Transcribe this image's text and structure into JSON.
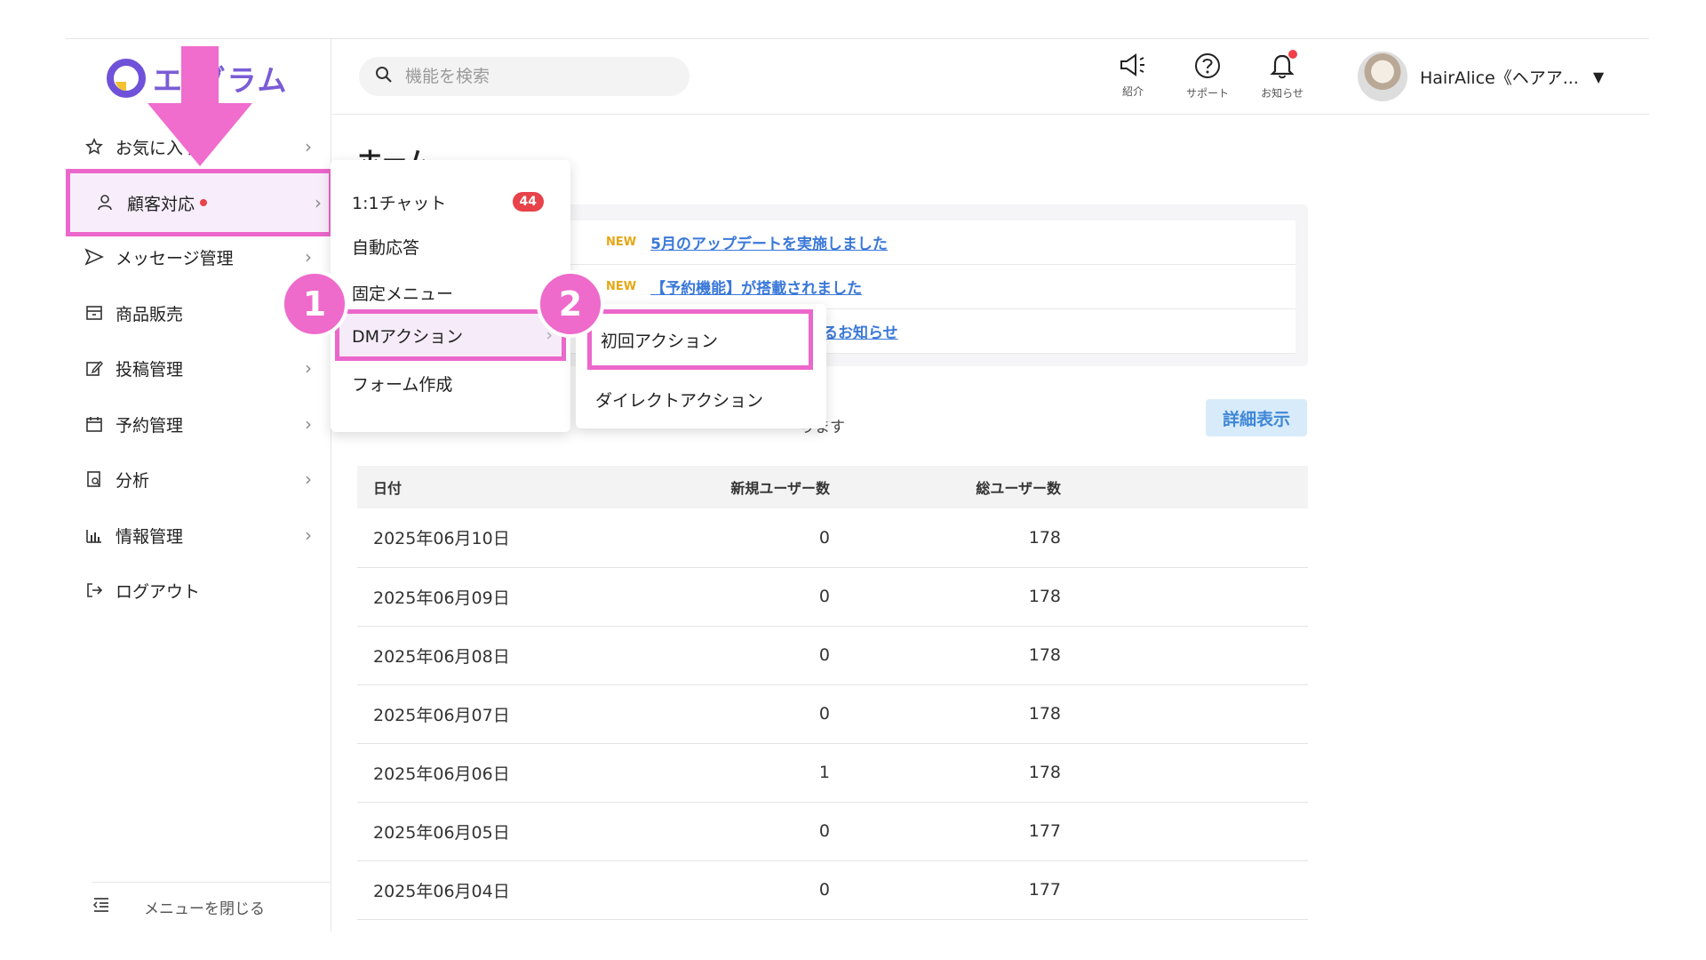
{
  "app": {
    "logo_text": "エ  グラム"
  },
  "sidebar": {
    "items": [
      {
        "label": "お気に入り"
      },
      {
        "label": "顧客対応"
      },
      {
        "label": "メッセージ管理"
      },
      {
        "label": "商品販売"
      },
      {
        "label": "投稿管理"
      },
      {
        "label": "予約管理"
      },
      {
        "label": "分析"
      },
      {
        "label": "情報管理"
      },
      {
        "label": "ログアウト"
      }
    ],
    "close_label": "メニューを閉じる"
  },
  "header": {
    "search_placeholder": "機能を検索",
    "intro_label": "紹介",
    "support_label": "サポート",
    "notify_label": "お知らせ",
    "user_name": "HairAlice《ヘアア..."
  },
  "main": {
    "title": "ホーム",
    "news": [
      {
        "tag": "NEW",
        "text": "5月のアップデートを実施しました"
      },
      {
        "tag": "NEW",
        "text": "【予約機能】が搭載されました"
      },
      {
        "tag": "",
        "text": "るお知らせ"
      }
    ],
    "summary_text": "ります",
    "detail_button": "詳細表示",
    "table": {
      "headers": [
        "日付",
        "新規ユーザー数",
        "総ユーザー数"
      ],
      "rows": [
        [
          "2025年06月10日",
          "0",
          "178"
        ],
        [
          "2025年06月09日",
          "0",
          "178"
        ],
        [
          "2025年06月08日",
          "0",
          "178"
        ],
        [
          "2025年06月07日",
          "0",
          "178"
        ],
        [
          "2025年06月06日",
          "1",
          "178"
        ],
        [
          "2025年06月05日",
          "0",
          "177"
        ],
        [
          "2025年06月04日",
          "0",
          "177"
        ]
      ]
    }
  },
  "flyout1": {
    "items": [
      {
        "label": "1:1チャット",
        "badge": "44"
      },
      {
        "label": "自動応答"
      },
      {
        "label": "固定メニュー"
      },
      {
        "label": "DMアクション"
      },
      {
        "label": "フォーム作成"
      }
    ]
  },
  "flyout2": {
    "items": [
      {
        "label": "初回アクション"
      },
      {
        "label": "ダイレクトアクション"
      }
    ]
  },
  "annotations": {
    "step1": "1",
    "step2": "2"
  },
  "colors": {
    "highlight": "#ec67cb",
    "brand": "#7b5cd6",
    "link": "#3a78d8"
  }
}
